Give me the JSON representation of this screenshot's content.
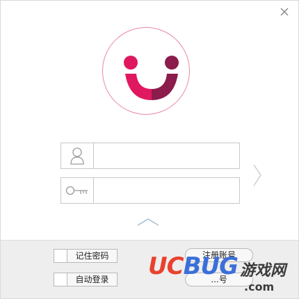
{
  "window": {
    "close_icon": "close-icon"
  },
  "logo": {
    "icon": "smiley-face-logo-icon",
    "colors": {
      "pink": "#e0185f",
      "dark": "#8b1c4c",
      "ring": "#e889a3"
    }
  },
  "login": {
    "account_icon": "user-icon",
    "password_icon": "key-icon",
    "account_value": "",
    "password_value": "",
    "next_icon": "chevron-right-icon",
    "expand_icon": "chevron-up-icon"
  },
  "options": {
    "remember_password_label": "记住密码",
    "auto_login_label": "自动登录",
    "remember_password_checked": false,
    "auto_login_checked": false
  },
  "actions": {
    "register_label": "注册账号",
    "second_label": "...号"
  },
  "watermark": {
    "brand_uc": "UC",
    "brand_bug": "BUG",
    "brand_cn": "游戏网",
    "brand_domain": ".com"
  }
}
